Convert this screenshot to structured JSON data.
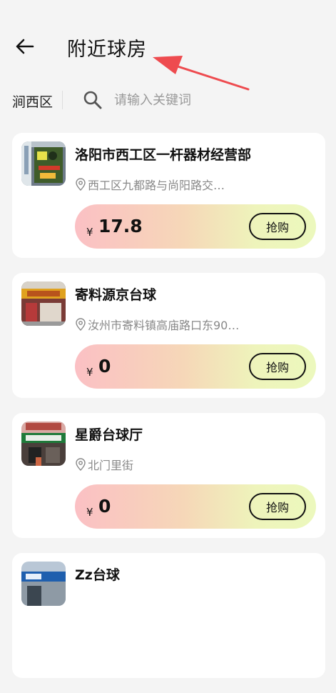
{
  "header": {
    "title": "附近球房"
  },
  "search": {
    "district": "涧西区",
    "placeholder": "请输入关键词"
  },
  "colors": {
    "annotation_arrow": "#ee4b4f",
    "price_gradient_start": "#fbc0c4",
    "price_gradient_end": "#ecf8bd"
  },
  "currency_symbol": "¥",
  "buy_label": "抢购",
  "venues": [
    {
      "name": "洛阳市西工区一杆器材经营部",
      "address": "西工区九都路与尚阳路交…",
      "price": "17.8"
    },
    {
      "name": "寄料源京台球",
      "address": "汝州市寄料镇高庙路口东90…",
      "price": "0"
    },
    {
      "name": "星爵台球厅",
      "address": "北门里街",
      "price": "0"
    },
    {
      "name": "Zz台球",
      "address": "",
      "price": ""
    }
  ]
}
